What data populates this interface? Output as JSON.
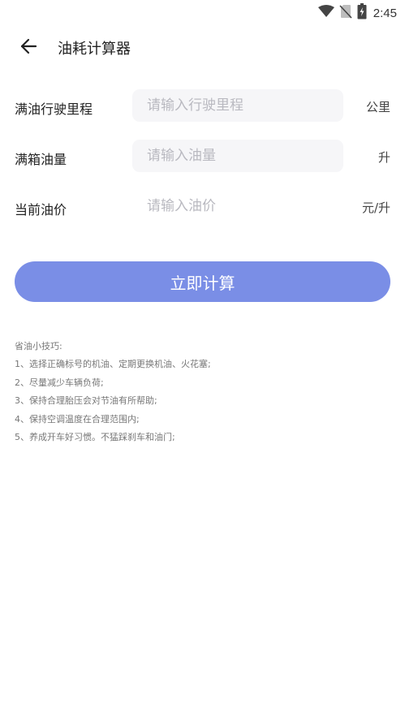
{
  "status_bar": {
    "time": "2:45",
    "icons": [
      "wifi-icon",
      "no-sim-icon",
      "battery-charging-icon"
    ]
  },
  "header": {
    "back_icon": "arrow-left-icon",
    "title": "油耗计算器"
  },
  "form": {
    "mileage": {
      "label": "满油行驶里程",
      "placeholder": "请输入行驶里程",
      "value": "",
      "unit": "公里"
    },
    "tank": {
      "label": "满箱油量",
      "placeholder": "请输入油量",
      "value": "",
      "unit": "升"
    },
    "price": {
      "label": "当前油价",
      "placeholder": "请输入油价",
      "value": "",
      "unit": "元/升"
    }
  },
  "actions": {
    "calculate_label": "立即计算"
  },
  "tips": {
    "title": "省油小技巧:",
    "items": [
      "1、选择正确标号的机油、定期更换机油、火花塞;",
      "2、尽量减少车辆负荷;",
      "3、保持合理胎压会对节油有所帮助;",
      "4、保持空调温度在合理范围内;",
      "5、养成开车好习惯。不猛踩刹车和油门;"
    ]
  },
  "colors": {
    "accent": "#7a8ee6",
    "input_bg": "#f6f6f8",
    "placeholder": "#b9b9c0"
  }
}
